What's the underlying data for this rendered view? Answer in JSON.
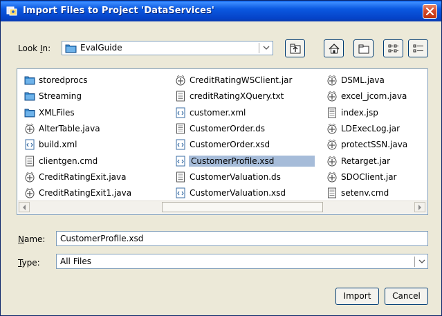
{
  "window": {
    "title": "Import Files to Project 'DataServices'"
  },
  "look_in": {
    "label_prefix": "Look ",
    "label_mnemonic": "I",
    "label_suffix": "n:",
    "value": "EvalGuide"
  },
  "toolbar": {
    "buttons": [
      "up-one-level",
      "home",
      "new-folder",
      "list-view",
      "details-view"
    ]
  },
  "files": [
    {
      "name": "storedprocs",
      "type": "folder"
    },
    {
      "name": "Streaming",
      "type": "folder"
    },
    {
      "name": "XMLFiles",
      "type": "folder"
    },
    {
      "name": "AlterTable.java",
      "type": "java"
    },
    {
      "name": "build.xml",
      "type": "xml"
    },
    {
      "name": "clientgen.cmd",
      "type": "text"
    },
    {
      "name": "CreditRatingExit.java",
      "type": "java"
    },
    {
      "name": "CreditRatingExit1.java",
      "type": "java"
    },
    {
      "name": "CreditRatingWSClient.jar",
      "type": "jar"
    },
    {
      "name": "creditRatingXQuery.txt",
      "type": "text"
    },
    {
      "name": "customer.xml",
      "type": "xml"
    },
    {
      "name": "CustomerOrder.ds",
      "type": "text"
    },
    {
      "name": "CustomerOrder.xsd",
      "type": "xml"
    },
    {
      "name": "CustomerProfile.xsd",
      "type": "xml",
      "selected": true
    },
    {
      "name": "CustomerValuation.ds",
      "type": "text"
    },
    {
      "name": "CustomerValuation.xsd",
      "type": "xml"
    },
    {
      "name": "DSML.java",
      "type": "java"
    },
    {
      "name": "excel_jcom.java",
      "type": "java"
    },
    {
      "name": "index.jsp",
      "type": "text"
    },
    {
      "name": "LDExecLog.jar",
      "type": "jar"
    },
    {
      "name": "protectSSN.java",
      "type": "java"
    },
    {
      "name": "Retarget.jar",
      "type": "jar"
    },
    {
      "name": "SDOClient.jar",
      "type": "jar"
    },
    {
      "name": "setenv.cmd",
      "type": "text"
    }
  ],
  "name_field": {
    "label_mnemonic": "N",
    "label_suffix": "ame:",
    "value": "CustomerProfile.xsd"
  },
  "type_field": {
    "label_mnemonic": "T",
    "label_suffix": "ype:",
    "value": "All Files"
  },
  "buttons": {
    "import": "Import",
    "cancel": "Cancel"
  },
  "colors": {
    "title_bar": "#0B58E0",
    "selection": "#A6BCD9",
    "folder_icon": "#3A8CCF",
    "close_button": "#D4492B"
  }
}
